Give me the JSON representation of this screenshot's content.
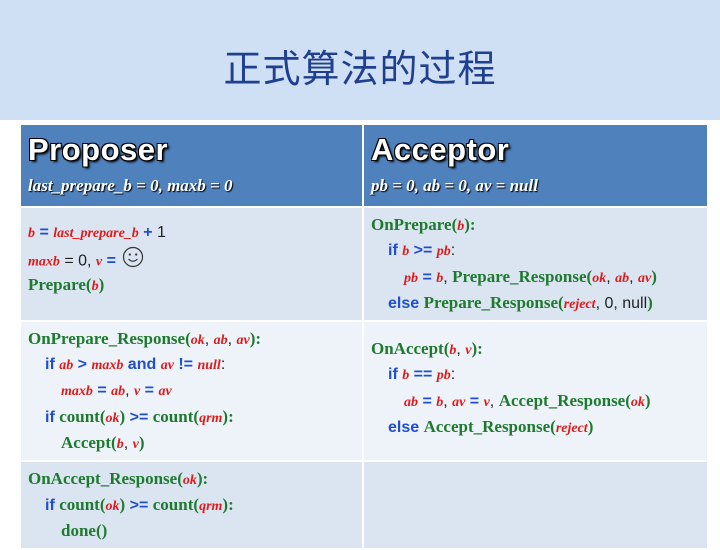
{
  "title": "正式算法的过程",
  "proposer": {
    "header": "Proposer",
    "init": "last_prepare_b = 0, maxb = 0",
    "cell1": {
      "b": "b",
      "assign": " = ",
      "last_prepare_b": "last_prepare_b",
      "plus": " + ",
      "one": "1",
      "maxb": "maxb",
      "eq0": " = 0, ",
      "v": "v",
      "eqv": " = ",
      "prepare_fn": "Prepare",
      "lp": "(",
      "prepare_arg": "b",
      "rp": ")"
    },
    "cell2": {
      "fn": "OnPrepare_Response",
      "lp": "(",
      "ok": "ok",
      "c1": ", ",
      "ab": "ab",
      "c2": ", ",
      "av": "av",
      "rp": "):",
      "if_kw": "if ",
      "cond_ab": "ab",
      "gt": " > ",
      "cond_maxb": "maxb",
      "and_kw": " and ",
      "cond_av": "av",
      "neq": " != ",
      "null": "null",
      "colon": ":",
      "a_maxb": "maxb",
      "a_eq1": " = ",
      "a_ab": "ab",
      "a_c": ", ",
      "a_v": "v",
      "a_eq2": " = ",
      "a_av": "av",
      "if2_kw": "if ",
      "count1": "count",
      "lp2": "(",
      "ok2": "ok",
      "rp2": ")",
      "ge": " >= ",
      "count2": "count",
      "lp3": "(",
      "qrm": "qrm",
      "rp3": "):",
      "accept_fn": "Accept",
      "lp4": "(",
      "acc_b": "b",
      "c3": ", ",
      "acc_v": "v",
      "rp4": ")"
    },
    "cell3": {
      "fn": "OnAccept_Response",
      "lp": "(",
      "ok": "ok",
      "rp": "):",
      "if_kw": "if ",
      "count1": "count",
      "lp2": "(",
      "ok2": "ok",
      "rp2": ")",
      "ge": " >= ",
      "count2": "count",
      "lp3": "(",
      "qrm": "qrm",
      "rp3": "):",
      "done": "done()"
    }
  },
  "acceptor": {
    "header": "Acceptor",
    "init": "pb = 0, ab = 0, av = null",
    "cell1": {
      "fn": "OnPrepare",
      "lp": "(",
      "b": "b",
      "rp": "):",
      "if_kw": "if ",
      "cb": "b",
      "ge": " >= ",
      "pb": "pb",
      "colon": ":",
      "a_pb": "pb",
      "a_eq": " = ",
      "a_b": "b",
      "a_c": ", ",
      "resp_fn": "Prepare_Response",
      "lp2": "(",
      "ok": "ok",
      "c1": ", ",
      "ab": "ab",
      "c2": ", ",
      "av": "av",
      "rp2": ")",
      "else_kw": "else ",
      "resp_fn2": "Prepare_Response",
      "lp3": "(",
      "reject": "reject",
      "rest": ", 0, null",
      "rp3": ")"
    },
    "cell2": {
      "fn": "OnAccept",
      "lp": "(",
      "b": "b",
      "c": ", ",
      "v": "v",
      "rp": "):",
      "if_kw": "if ",
      "cb": "b",
      "eqeq": " == ",
      "pb": "pb",
      "colon": ":",
      "a_ab": "ab",
      "a_eq1": " = ",
      "a_b": "b",
      "a_c1": ", ",
      "a_av": "av",
      "a_eq2": " = ",
      "a_v": "v",
      "a_c2": ", ",
      "resp_fn": "Accept_Response",
      "lp2": "(",
      "ok": "ok",
      "rp2": ")",
      "else_kw": "else ",
      "resp_fn2": "Accept_Response",
      "lp3": "(",
      "reject": "reject",
      "rp3": ")"
    },
    "cell3": {}
  },
  "icons": {
    "smiley": "smiley-face-icon"
  },
  "colors": {
    "header_bg": "#4f81bd",
    "row_dark": "#dbe5f1",
    "row_light": "#eef3f9",
    "banner": "#cfdff4",
    "title": "#1f3f8f"
  }
}
